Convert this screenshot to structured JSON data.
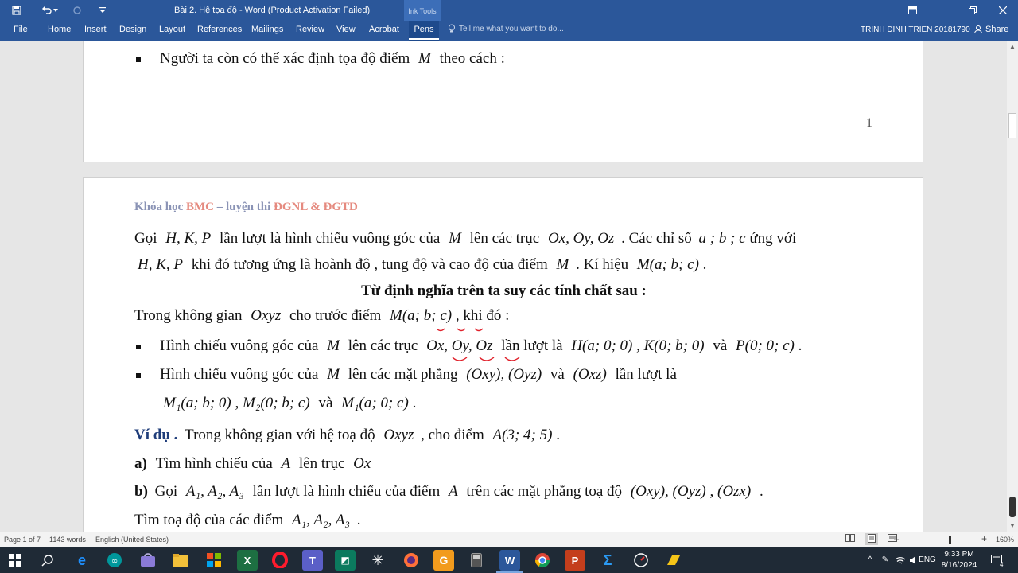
{
  "window": {
    "title": "Bài 2. Hệ tọa độ - Word (Product Activation Failed)",
    "context_tab": "Ink Tools"
  },
  "ribbon": {
    "tabs": [
      "File",
      "Home",
      "Insert",
      "Design",
      "Layout",
      "References",
      "Mailings",
      "Review",
      "View",
      "Acrobat",
      "Pens"
    ],
    "active_tab": "Pens",
    "tell_me_placeholder": "Tell me what you want to do...",
    "user": "TRINH DINH TRIEN 20181790",
    "share": "Share"
  },
  "page1": {
    "bullet_text": "Người ta còn có thể xác định tọa độ điểm",
    "bullet_var": "M",
    "bullet_tail": "theo cách :",
    "page_number": "1"
  },
  "page2": {
    "header": {
      "part1": "Khóa học",
      "part2": "BMC",
      "part3": "– luyện thi",
      "part4": "ĐGNL & ĐGTD"
    },
    "p1_line1_a": "Gọi",
    "p1_line1_vars": "H, K, P",
    "p1_line1_b": "lần lượt là hình chiếu vuông góc của",
    "p1_line1_m": "M",
    "p1_line1_c": "lên các trục",
    "p1_line1_axes": "Ox, Oy, Oz",
    "p1_line1_d": ". Các chỉ số",
    "p1_line1_idx": "a ; b ; c",
    "p1_line1_e": "ứng với",
    "p1_line2_vars": "H, K, P",
    "p1_line2_a": "khi đó tương ứng là hoành độ , tung độ và cao độ của điểm",
    "p1_line2_m": "M",
    "p1_line2_b": ". Kí hiệu",
    "p1_line2_sym": "M(a; b; c)",
    "p1_line2_end": ".",
    "heading": "Từ định nghĩa trên ta suy các tính chất sau :",
    "given_a": "Trong không gian",
    "given_oxyz": "Oxyz",
    "given_b": "cho trước điểm",
    "given_pt": "M(a; b; c)",
    "given_c": ", khi đó :",
    "b1_a": "Hình chiếu vuông góc của",
    "b1_m": "M",
    "b1_b": "lên các trục",
    "b1_axes": "Ox, Oy, Oz",
    "b1_c": "lần lượt là",
    "b1_h": "H(a; 0; 0)",
    "b1_k": ", K(0; b; 0)",
    "b1_and": "và",
    "b1_p": "P(0; 0; c)",
    "b1_end": ".",
    "b2_a": "Hình chiếu vuông góc của",
    "b2_m": "M",
    "b2_b": "lên các mặt phẳng",
    "b2_planes": "(Oxy), (Oyz)",
    "b2_and": "và",
    "b2_oxz": "(Oxz)",
    "b2_c": "lần lượt là",
    "b2_m1": "M₁(a; b; 0)",
    "b2_m2": ", M₂(0; b; c)",
    "b2_and2": "và",
    "b2_m3": "M₁(a; 0; c)",
    "b2_end": ".",
    "ex_label": "Ví dụ .",
    "ex_a": "Trong không gian với hệ toạ độ",
    "ex_oxyz": "Oxyz",
    "ex_b": ", cho điểm",
    "ex_pt": "A(3; 4; 5)",
    "ex_end": ".",
    "qa_label": "a)",
    "qa_text": "Tìm hình chiếu của",
    "qa_a": "A",
    "qa_b": "lên trục",
    "qa_ox": "Ox",
    "qb_label": "b)",
    "qb_text": "Gọi",
    "qb_vars": "A₁, A₂, A₃",
    "qb_b": "lần lượt là hình chiếu của điểm",
    "qb_a": "A",
    "qb_c": "trên các mặt phẳng toạ độ",
    "qb_planes": "(Oxy), (Oyz) , (Ozx)",
    "qb_end": ".",
    "last_a": "Tìm toạ độ của các điểm",
    "last_vars": "A₁, A₂, A₃",
    "last_end": "."
  },
  "status": {
    "page": "Page 1 of 7",
    "words": "1143 words",
    "language": "English (United States)",
    "zoom": "160%"
  },
  "taskbar": {
    "lang": "ENG",
    "time": "9:33 PM",
    "date": "8/16/2024",
    "notifications": "4"
  }
}
